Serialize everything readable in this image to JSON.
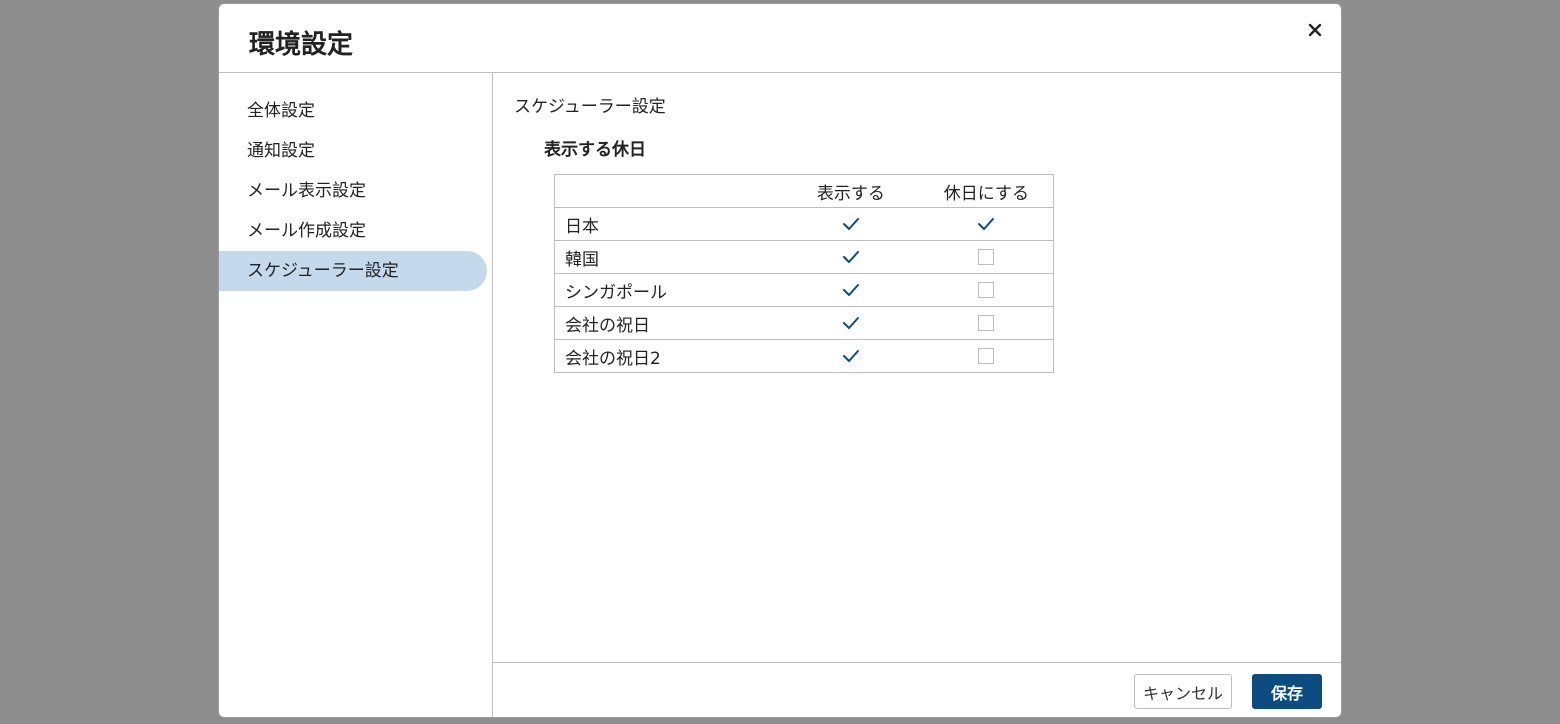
{
  "modal": {
    "title": "環境設定",
    "close_icon": "close-icon"
  },
  "sidebar": {
    "items": [
      {
        "label": "全体設定",
        "active": false
      },
      {
        "label": "通知設定",
        "active": false
      },
      {
        "label": "メール表示設定",
        "active": false
      },
      {
        "label": "メール作成設定",
        "active": false
      },
      {
        "label": "スケジューラー設定",
        "active": true
      }
    ]
  },
  "content": {
    "section_title": "スケジューラー設定",
    "subsection_title": "表示する休日",
    "table": {
      "headers": [
        "",
        "表示する",
        "休日にする"
      ],
      "rows": [
        {
          "name": "日本",
          "show": true,
          "holiday": true
        },
        {
          "name": "韓国",
          "show": true,
          "holiday": false
        },
        {
          "name": "シンガポール",
          "show": true,
          "holiday": false
        },
        {
          "name": "会社の祝日",
          "show": true,
          "holiday": false
        },
        {
          "name": "会社の祝日2",
          "show": true,
          "holiday": false
        }
      ]
    }
  },
  "footer": {
    "cancel_label": "キャンセル",
    "save_label": "保存"
  },
  "colors": {
    "accent": "#0b4d80",
    "sidebar_active": "#c5d9ec",
    "overlay": "#8e8e8e",
    "check": "#0b4d80"
  }
}
